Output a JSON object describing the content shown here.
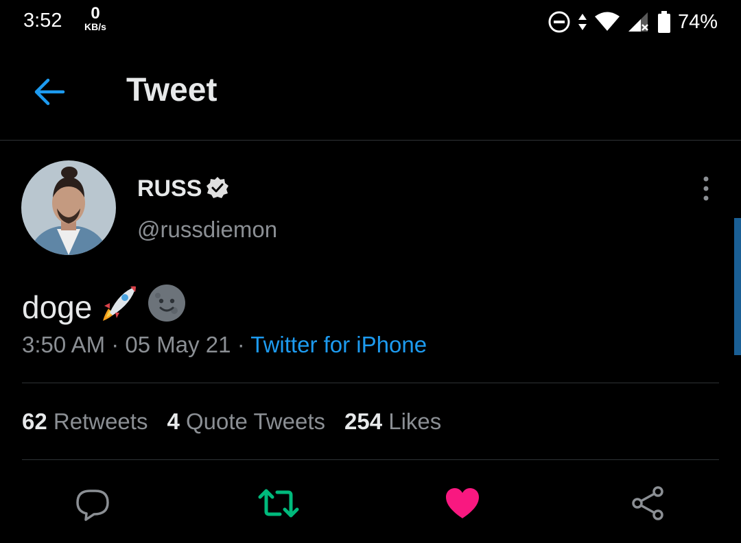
{
  "status_bar": {
    "time": "3:52",
    "net_speed_value": "0",
    "net_speed_unit": "KB/s",
    "icons": [
      "do-not-disturb-icon",
      "data-arrows-icon",
      "wifi-icon",
      "cell-signal-icon",
      "battery-icon"
    ],
    "battery_percent": "74%"
  },
  "header": {
    "back_icon": "arrow-left-icon",
    "title": "Tweet"
  },
  "tweet": {
    "author": {
      "display_name": "RUSS",
      "handle": "@russdiemon",
      "verified": true
    },
    "text": "doge",
    "emojis": [
      "rocket-emoji",
      "new-moon-face-emoji"
    ],
    "meta": {
      "time": "3:50 AM",
      "separator": "·",
      "date": "05 May 21",
      "source": "Twitter for iPhone"
    },
    "stats": {
      "retweets_count": "62",
      "retweets_label": "Retweets",
      "quotes_count": "4",
      "quotes_label": "Quote Tweets",
      "likes_count": "254",
      "likes_label": "Likes"
    }
  },
  "actions": [
    "reply-icon",
    "retweet-icon",
    "like-icon",
    "share-icon"
  ],
  "colors": {
    "background": "#000000",
    "accent_blue": "#1d9bf0",
    "retweet_green": "#00ba7c",
    "like_pink": "#f91880",
    "secondary_text": "#8b8f94",
    "divider": "#2f3336"
  }
}
